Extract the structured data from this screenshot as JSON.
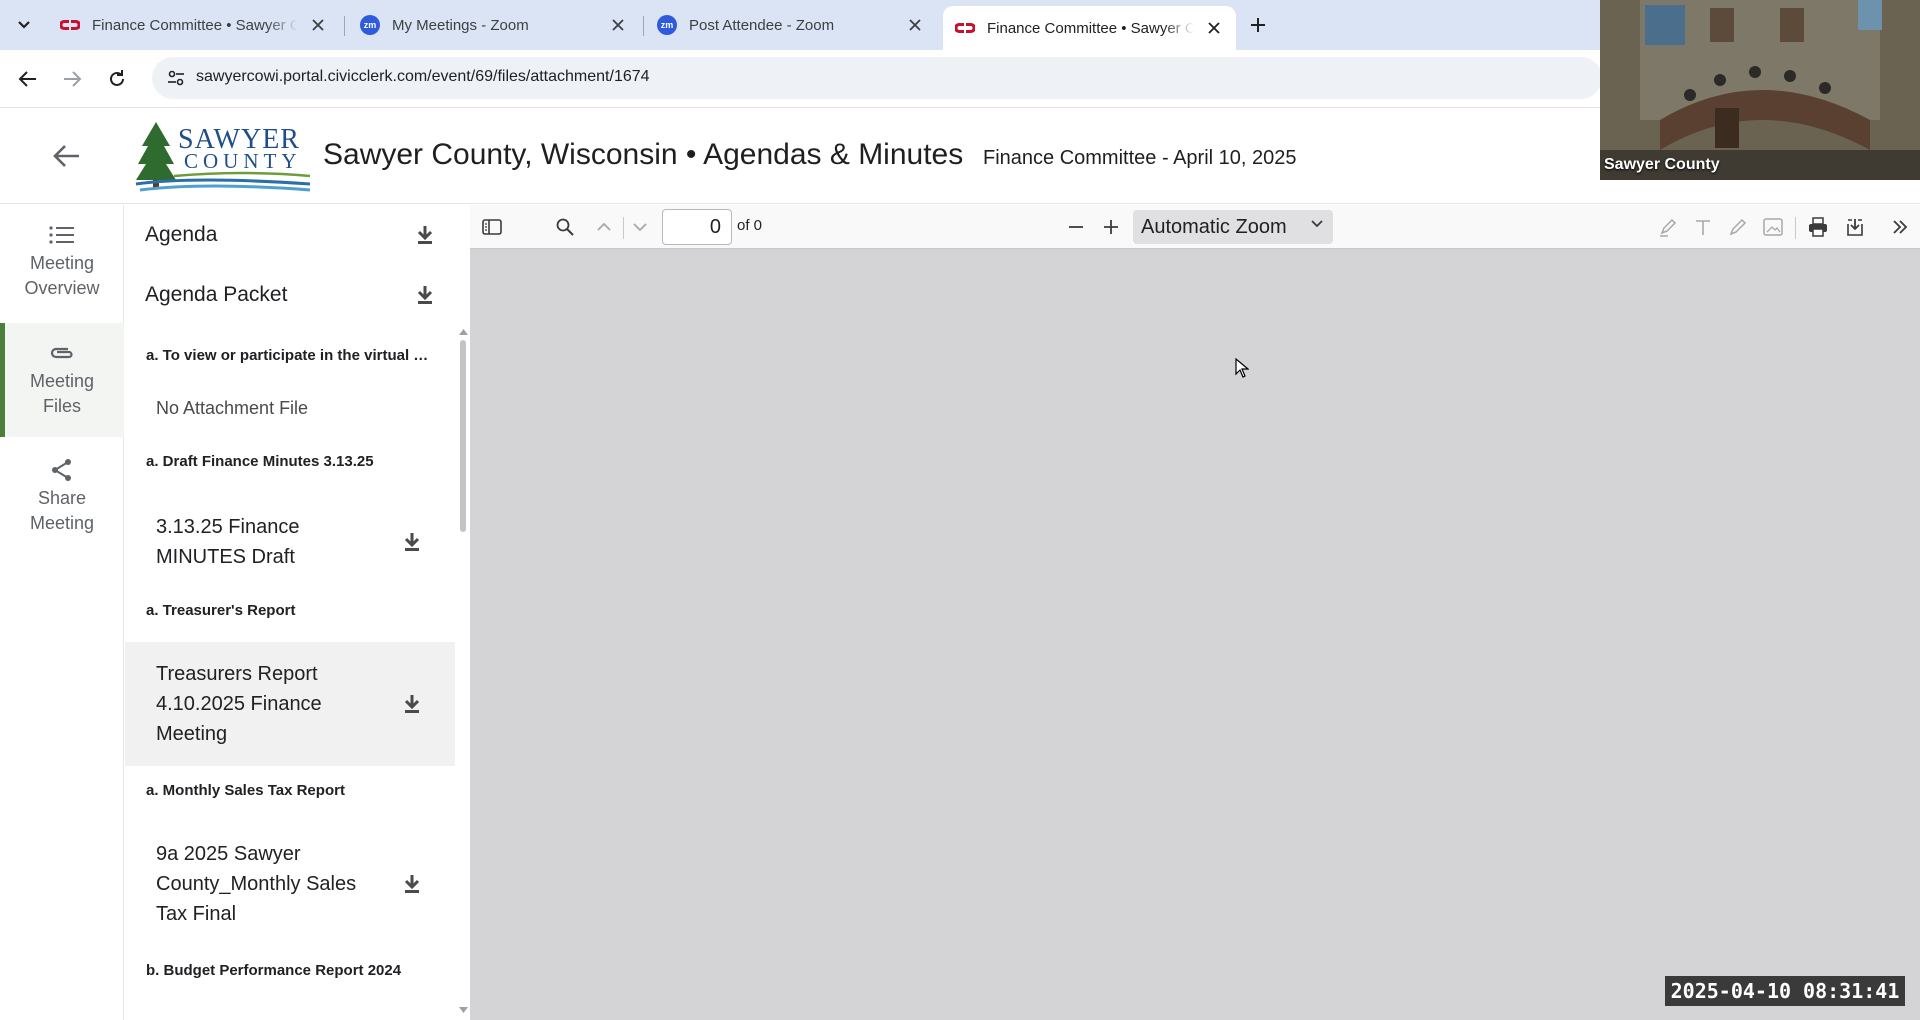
{
  "browser": {
    "tabs": [
      {
        "title": "Finance Committee • Sawyer County",
        "favicon": "civicclerk-icon",
        "active": false
      },
      {
        "title": "My Meetings - Zoom",
        "favicon": "zoom-icon",
        "active": false
      },
      {
        "title": "Post Attendee - Zoom",
        "favicon": "zoom-icon",
        "active": false
      },
      {
        "title": "Finance Committee • Sawyer County",
        "favicon": "civicclerk-icon",
        "active": true
      }
    ],
    "zoom_badge": "zm",
    "url": "sawyercowi.portal.civicclerk.com/event/69/files/attachment/1674"
  },
  "header": {
    "logo_top": "SAWYER",
    "logo_bottom": "COUNTY",
    "site_title": "Sawyer County, Wisconsin • Agendas & Minutes",
    "meeting_title": "Finance Committee - April 10, 2025"
  },
  "rail": {
    "items": [
      {
        "line1": "Meeting",
        "line2": "Overview",
        "icon": "list-icon",
        "active": false
      },
      {
        "line1": "Meeting",
        "line2": "Files",
        "icon": "paperclip-icon",
        "active": true
      },
      {
        "line1": "Share",
        "line2": "Meeting",
        "icon": "share-icon",
        "active": false
      }
    ]
  },
  "files": {
    "agenda": "Agenda",
    "agenda_packet": "Agenda Packet",
    "sections": [
      {
        "label": "a. To view or participate in the virtual …",
        "no_file": "No Attachment File"
      },
      {
        "label": "a. Draft Finance Minutes 3.13.25",
        "file": [
          "3.13.25 Finance",
          "MINUTES Draft"
        ]
      },
      {
        "label": "a. Treasurer's Report",
        "file": [
          "Treasurers Report",
          "4.10.2025 Finance",
          "Meeting"
        ]
      },
      {
        "label": "a. Monthly Sales Tax Report",
        "file": [
          "9a 2025 Sawyer",
          "County_Monthly Sales",
          "Tax Final"
        ]
      },
      {
        "label": "b. Budget Performance Report 2024"
      }
    ]
  },
  "viewer": {
    "page_number": "0",
    "page_of": "of 0",
    "zoom": "Automatic Zoom"
  },
  "video": {
    "label": "Sawyer County"
  },
  "timestamp": "2025-04-10 08:31:41",
  "colors": {
    "tabstrip": "#dbe4f5",
    "accent_green": "#4b7f3d",
    "viewer_bg": "#d4d4d7",
    "civicclerk_red": "#c8102e",
    "zoom_blue": "#2d5bdc"
  }
}
